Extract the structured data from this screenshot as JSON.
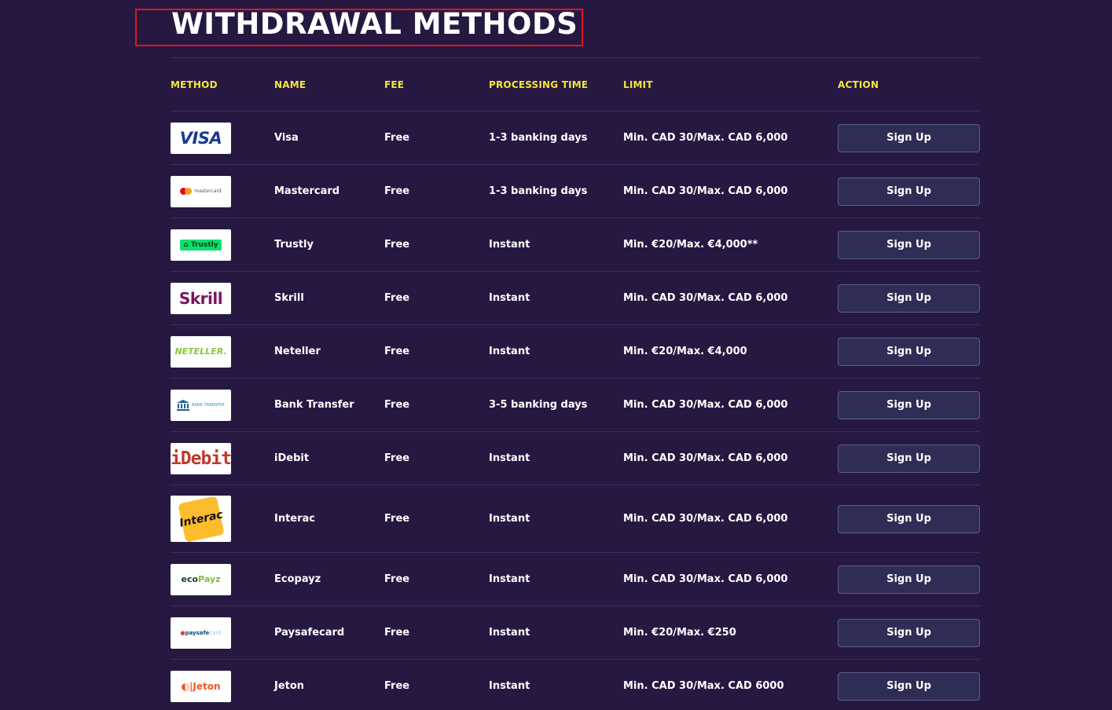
{
  "title": "WITHDRAWAL METHODS",
  "headers": {
    "method": "METHOD",
    "name": "NAME",
    "fee": "FEE",
    "processing": "PROCESSING TIME",
    "limit": "LIMIT",
    "action": "ACTION"
  },
  "colors": {
    "background": "#271842",
    "header": "#f5e636",
    "highlight_border": "#e0141e",
    "button": "#2f2d55"
  },
  "rows": [
    {
      "logo_text": "VISA",
      "name": "Visa",
      "fee": "Free",
      "processing": "1-3 banking days",
      "limit": "Min. CAD 30/Max. CAD 6,000",
      "action": "Sign Up"
    },
    {
      "logo_text": "mastercard",
      "name": "Mastercard",
      "fee": "Free",
      "processing": "1-3 banking days",
      "limit": "Min. CAD 30/Max. CAD 6,000",
      "action": "Sign Up"
    },
    {
      "logo_text": "Trustly",
      "name": "Trustly",
      "fee": "Free",
      "processing": "Instant",
      "limit": "Min. €20/Max. €4,000**",
      "action": "Sign Up"
    },
    {
      "logo_text": "Skrill",
      "name": "Skrill",
      "fee": "Free",
      "processing": "Instant",
      "limit": "Min. CAD 30/Max. CAD 6,000",
      "action": "Sign Up"
    },
    {
      "logo_text": "NETELLER.",
      "name": "Neteller",
      "fee": "Free",
      "processing": "Instant",
      "limit": "Min. €20/Max. €4,000",
      "action": "Sign Up"
    },
    {
      "logo_text": "BANK TRANSFER",
      "name": "Bank Transfer",
      "fee": "Free",
      "processing": "3-5 banking days",
      "limit": "Min. CAD 30/Max. CAD 6,000",
      "action": "Sign Up"
    },
    {
      "logo_text": "iDebit",
      "name": "iDebit",
      "fee": "Free",
      "processing": "Instant",
      "limit": "Min. CAD 30/Max. CAD 6,000",
      "action": "Sign Up"
    },
    {
      "logo_text": "Interac",
      "name": "Interac",
      "fee": "Free",
      "processing": "Instant",
      "limit": "Min. CAD 30/Max. CAD 6,000",
      "action": "Sign Up"
    },
    {
      "logo_text_a": "eco",
      "logo_text_b": "Payz",
      "name": "Ecopayz",
      "fee": "Free",
      "processing": "Instant",
      "limit": "Min. CAD 30/Max. CAD 6,000",
      "action": "Sign Up"
    },
    {
      "logo_text_a": "paysafe",
      "logo_text_b": "card",
      "name": "Paysafecard",
      "fee": "Free",
      "processing": "Instant",
      "limit": "Min. €20/Max. €250",
      "action": "Sign Up"
    },
    {
      "logo_text": "Jeton",
      "name": "Jeton",
      "fee": "Free",
      "processing": "Instant",
      "limit": "Min. CAD 30/Max. CAD 6000",
      "action": "Sign Up"
    }
  ]
}
